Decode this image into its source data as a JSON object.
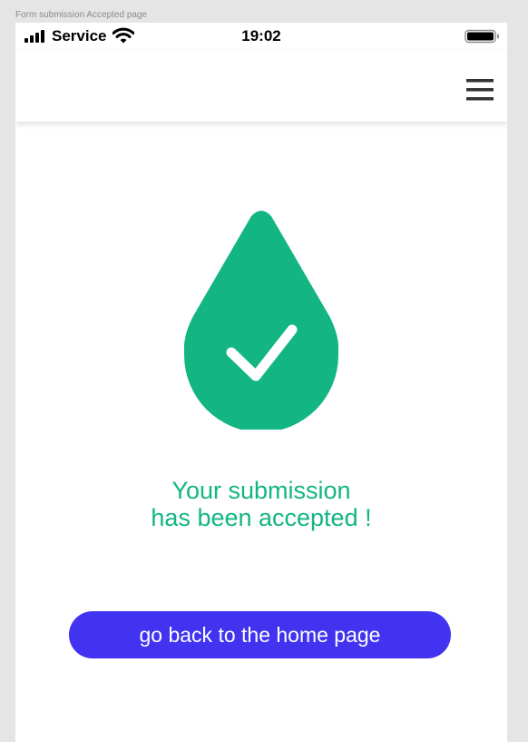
{
  "canvas": {
    "label": "Form submission Accepted page"
  },
  "status_bar": {
    "signal_icon": "cellular-signal-icon",
    "carrier": "Service",
    "wifi_icon": "wifi-icon",
    "time": "19:02",
    "battery_icon": "battery-icon"
  },
  "nav_bar": {
    "menu_icon": "hamburger-menu-icon"
  },
  "confirmation": {
    "icon": "check-drop-icon",
    "line1": "Your submission",
    "line2": "has been accepted !"
  },
  "actions": {
    "home_button_label": "go back to the home page"
  },
  "colors": {
    "accent_green": "#13b583",
    "button_blue": "#4133f0",
    "background": "#e5e5e5"
  }
}
